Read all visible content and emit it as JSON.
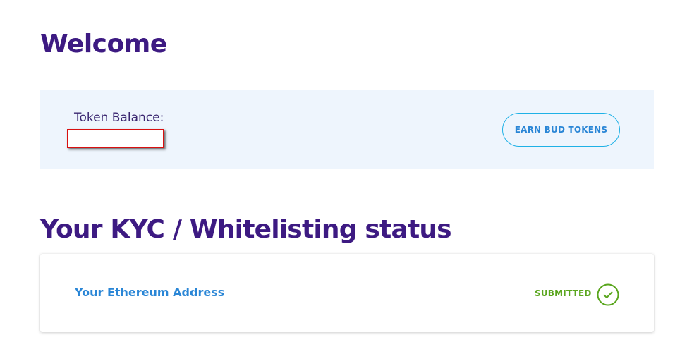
{
  "header": {
    "title": "Welcome"
  },
  "balance": {
    "label": "Token Balance:",
    "value": "",
    "earn_button_label": "EARN BUD TOKENS"
  },
  "kyc": {
    "section_title": "Your KYC / Whitelisting status",
    "address_label": "Your Ethereum Address",
    "status": "SUBMITTED",
    "status_icon": "check-circle-icon"
  },
  "colors": {
    "heading": "#3d1a82",
    "accent_blue": "#2a86d6",
    "button_border": "#1fb1e6",
    "panel_bg": "#eef5fd",
    "status_green": "#5aa61e",
    "highlight_red": "#d81010"
  }
}
